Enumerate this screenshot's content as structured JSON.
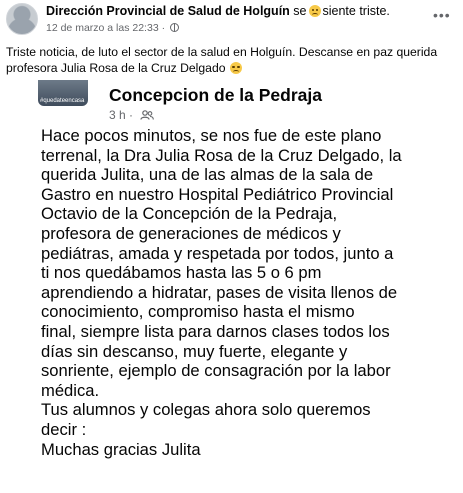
{
  "post": {
    "page_name": "Dirección Provincial de Salud de Holguín",
    "feeling_prefix": "se",
    "feeling_text": "siente triste.",
    "timestamp": "12 de marzo a las 22:33",
    "text": "Triste noticia, de luto el sector de la salud en Holguín. Descanse en paz querida profesora Julia Rosa de la Cruz Delgado",
    "icons": {
      "feeling_emoji": "sad-face-icon",
      "text_emoji": "crying-face-icon",
      "audience": "globe-icon",
      "more": "more-options-icon"
    }
  },
  "shared": {
    "thumb_label": "#quedateencasa",
    "title": "Concepcion de la Pedraja",
    "time": "3 h",
    "separator": "·",
    "audience_icon": "friends-icon",
    "body_lines": [
      "Hace pocos minutos, se nos fue de este plano",
      "terrenal, la Dra Julia Rosa de la Cruz Delgado, la",
      "querida Julita, una de las almas de la sala de",
      "Gastro en nuestro Hospital Pediátrico Provincial",
      "Octavio de la Concepción de la Pedraja,",
      "profesora de generaciones de médicos y",
      "pediátras, amada y respetada por todos, junto a",
      "ti nos quedábamos hasta las 5 o 6 pm",
      "aprendiendo a hidratar, pases de visita llenos de",
      "conocimiento, compromiso hasta el mismo",
      "final, siempre lista para darnos clases todos los",
      "días sin descanso, muy fuerte, elegante y",
      "sonriente, ejemplo de consagración por la labor",
      "médica.",
      "Tus alumnos y colegas ahora solo queremos",
      "decir :",
      "Muchas gracias Julita"
    ]
  }
}
